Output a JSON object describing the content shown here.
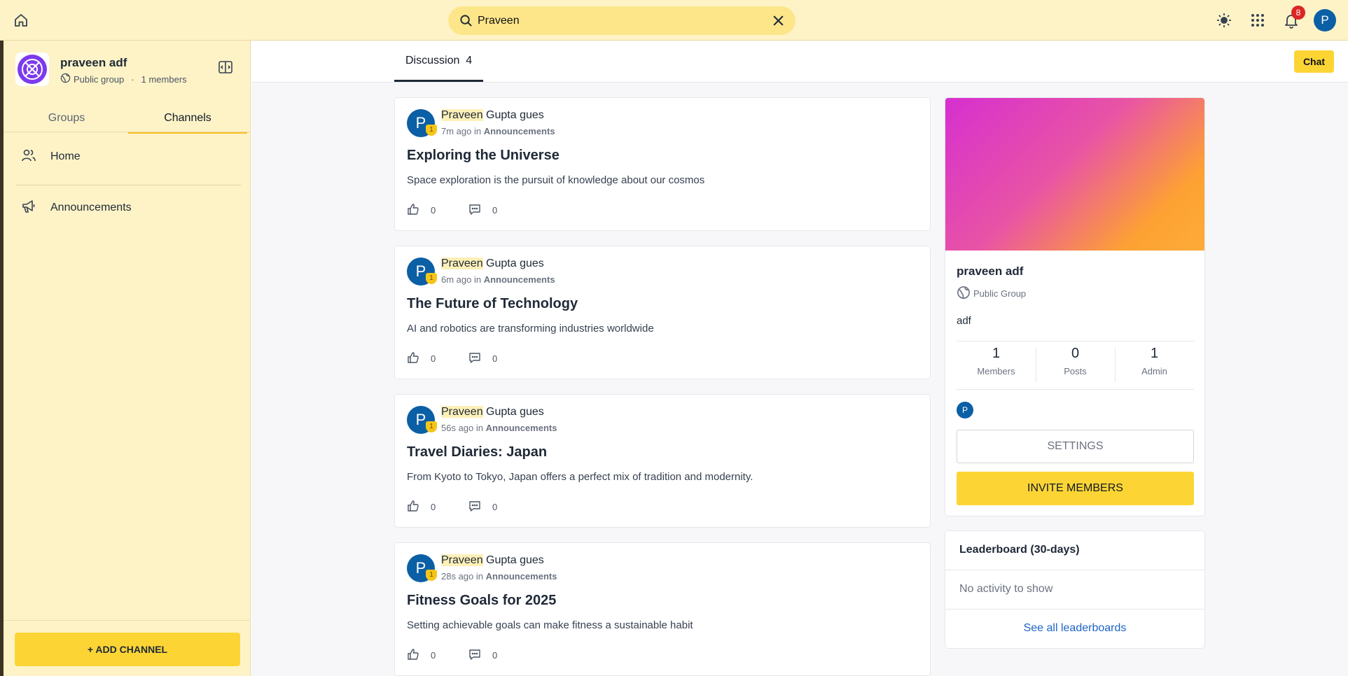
{
  "colors": {
    "accent": "#fcd535",
    "topbar_bg": "#fef3c7",
    "avatar_blue": "#0b5fa5",
    "link": "#1d64c7",
    "badge_red": "#dc2626"
  },
  "topbar": {
    "search_value": "Praveen",
    "notification_count": "8",
    "avatar_initial": "P",
    "icons": [
      "home-icon",
      "search-icon",
      "close-icon",
      "sun-icon",
      "apps-grid-icon",
      "bell-icon"
    ]
  },
  "sidebar": {
    "group_name": "praveen adf",
    "group_type": "Public group",
    "separator": "·",
    "members_text": "1 members",
    "tabs": [
      {
        "label": "Groups",
        "active": false
      },
      {
        "label": "Channels",
        "active": true
      }
    ],
    "nav": [
      {
        "label": "Home",
        "icon": "users-icon"
      },
      {
        "label": "Announcements",
        "icon": "megaphone-icon"
      }
    ],
    "add_channel_label": "+ ADD CHANNEL"
  },
  "main": {
    "tab_label": "Discussion",
    "tab_count": "4",
    "chat_label": "Chat",
    "posts": [
      {
        "avatar": "P",
        "badge": "1",
        "author_highlight": "Praveen",
        "author_rest": " Gupta gues",
        "time": "7m ago",
        "in": " in ",
        "channel": "Announcements",
        "title": "Exploring the Universe",
        "body": "Space exploration is the pursuit of knowledge about our cosmos",
        "likes": "0",
        "comments": "0"
      },
      {
        "avatar": "P",
        "badge": "1",
        "author_highlight": "Praveen",
        "author_rest": " Gupta gues",
        "time": "6m ago",
        "in": " in ",
        "channel": "Announcements",
        "title": "The Future of Technology",
        "body": "AI and robotics are transforming industries worldwide",
        "likes": "0",
        "comments": "0"
      },
      {
        "avatar": "P",
        "badge": "1",
        "author_highlight": "Praveen",
        "author_rest": " Gupta gues",
        "time": "56s ago",
        "in": " in ",
        "channel": "Announcements",
        "title": "Travel Diaries: Japan",
        "body": "From Kyoto to Tokyo, Japan offers a perfect mix of tradition and modernity.",
        "likes": "0",
        "comments": "0"
      },
      {
        "avatar": "P",
        "badge": "1",
        "author_highlight": "Praveen",
        "author_rest": " Gupta gues",
        "time": "28s ago",
        "in": " in ",
        "channel": "Announcements",
        "title": "Fitness Goals for 2025",
        "body": "Setting achievable goals can make fitness a sustainable habit",
        "likes": "0",
        "comments": "0"
      }
    ]
  },
  "group_card": {
    "name": "praveen adf",
    "type": "Public Group",
    "description": "adf",
    "stats": [
      {
        "value": "1",
        "label": "Members"
      },
      {
        "value": "0",
        "label": "Posts"
      },
      {
        "value": "1",
        "label": "Admin"
      }
    ],
    "member_initial": "P",
    "settings_label": "SETTINGS",
    "invite_label": "INVITE MEMBERS"
  },
  "leaderboard": {
    "title": "Leaderboard (30-days)",
    "empty_text": "No activity to show",
    "link_label": "See all leaderboards"
  }
}
